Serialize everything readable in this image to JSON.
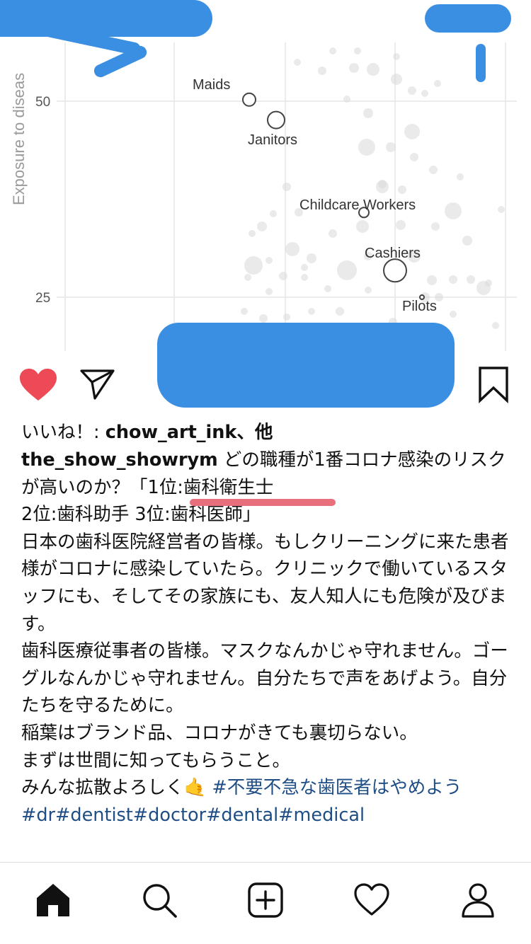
{
  "chart": {
    "y_axis_label": "Exposure to diseas",
    "y_ticks": [
      "50",
      "25"
    ],
    "points": [
      {
        "name": "Maids",
        "value": 50.2
      },
      {
        "name": "Janitors",
        "value": 47.6
      },
      {
        "name": "Childcare Workers",
        "value": 35.8
      },
      {
        "name": "Cashiers",
        "value": 28.4
      },
      {
        "name": "Pilots",
        "value": 25.0
      }
    ]
  },
  "chart_data": {
    "type": "scatter",
    "title": "",
    "xlabel": "",
    "ylabel": "Exposure to diseas",
    "yticks": [
      25,
      50
    ],
    "series": [
      {
        "points": [
          {
            "label": "Maids",
            "y": 50.2
          },
          {
            "label": "Janitors",
            "y": 47.6
          },
          {
            "label": "Childcare Workers",
            "y": 35.8
          },
          {
            "label": "Cashiers",
            "y": 28.4
          },
          {
            "label": "Pilots",
            "y": 25.0
          }
        ]
      }
    ],
    "grid": true
  },
  "actions": {
    "like_icon": "heart-filled-icon",
    "share_icon": "paper-plane-icon",
    "save_icon": "bookmark-icon",
    "like_color": "#ed4956"
  },
  "likes": {
    "prefix": "いいね！: ",
    "user": "chow_art_ink",
    "suffix": "、他"
  },
  "caption": {
    "username": "the_show_showrym",
    "line_1": " どの職種が1番コロナ感染のリスクが高いのか？「",
    "highlight": "1位:歯科衛生士",
    "line_2": " 2位:歯科助手 3位:歯科医師」",
    "paragraph_1": "日本の歯科医院経営者の皆様。もしクリーニングに来た患者様がコロナに感染していたら。クリニックで働いているスタッフにも、そしてその家族にも、友人知人にも危険が及びます。",
    "paragraph_2": "歯科医療従事者の皆様。マスクなんかじゃ守れません。ゴーグルなんかじゃ守れません。自分たちで声をあげよう。自分たちを守るために。",
    "paragraph_3": "稲葉はブランド品、コロナがきても裏切らない。",
    "paragraph_4": "まずは世間に知ってもらうこと。",
    "paragraph_5": "みんな拡散よろしく",
    "emoji": "🤙",
    "hashtag_1": " #不要不急な歯医者はやめよう",
    "hashtags_2": "#dr#dentist#doctor#dental#medical"
  },
  "nav": {
    "items": [
      "home-icon",
      "search-icon",
      "new-post-icon",
      "activity-heart-icon",
      "profile-icon"
    ]
  }
}
